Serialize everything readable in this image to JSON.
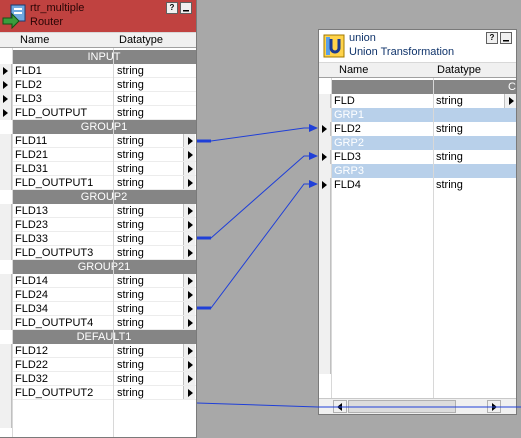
{
  "router": {
    "title_line1": "rtr_multiple",
    "title_line2": "Router",
    "help_btn": "?",
    "header": {
      "name": "Name",
      "datatype": "Datatype"
    },
    "groups": [
      {
        "label": "INPUT",
        "ports": [
          {
            "name": "FLD1",
            "type": "string"
          },
          {
            "name": "FLD2",
            "type": "string"
          },
          {
            "name": "FLD3",
            "type": "string"
          },
          {
            "name": "FLD_OUTPUT",
            "type": "string"
          }
        ]
      },
      {
        "label": "GROUP1",
        "ports": [
          {
            "name": "FLD11",
            "type": "string"
          },
          {
            "name": "FLD21",
            "type": "string"
          },
          {
            "name": "FLD31",
            "type": "string"
          },
          {
            "name": "FLD_OUTPUT1",
            "type": "string"
          }
        ]
      },
      {
        "label": "GROUP2",
        "ports": [
          {
            "name": "FLD13",
            "type": "string"
          },
          {
            "name": "FLD23",
            "type": "string"
          },
          {
            "name": "FLD33",
            "type": "string"
          },
          {
            "name": "FLD_OUTPUT3",
            "type": "string"
          }
        ]
      },
      {
        "label": "GROUP21",
        "ports": [
          {
            "name": "FLD14",
            "type": "string"
          },
          {
            "name": "FLD24",
            "type": "string"
          },
          {
            "name": "FLD34",
            "type": "string"
          },
          {
            "name": "FLD_OUTPUT4",
            "type": "string"
          }
        ]
      },
      {
        "label": "DEFAULT1",
        "ports": [
          {
            "name": "FLD12",
            "type": "string"
          },
          {
            "name": "FLD22",
            "type": "string"
          },
          {
            "name": "FLD32",
            "type": "string"
          },
          {
            "name": "FLD_OUTPUT2",
            "type": "string"
          }
        ]
      }
    ]
  },
  "union": {
    "title_line1": "union",
    "title_line2": "Union Transformation",
    "help_btn": "?",
    "header": {
      "name": "Name",
      "datatype": "Datatype"
    },
    "top_row_stub": "C",
    "rows": [
      {
        "kind": "port",
        "name": "FLD",
        "type": "string"
      },
      {
        "kind": "group",
        "name": "GRP1"
      },
      {
        "kind": "port",
        "name": "FLD2",
        "type": "string"
      },
      {
        "kind": "group",
        "name": "GRP2"
      },
      {
        "kind": "port",
        "name": "FLD3",
        "type": "string"
      },
      {
        "kind": "group",
        "name": "GRP3"
      },
      {
        "kind": "port",
        "name": "FLD4",
        "type": "string"
      }
    ]
  },
  "colors": {
    "router_title": "#c04240",
    "union_group_row": "#b8d0ea",
    "group_header": "#858585",
    "link": "#1f3fd8"
  }
}
